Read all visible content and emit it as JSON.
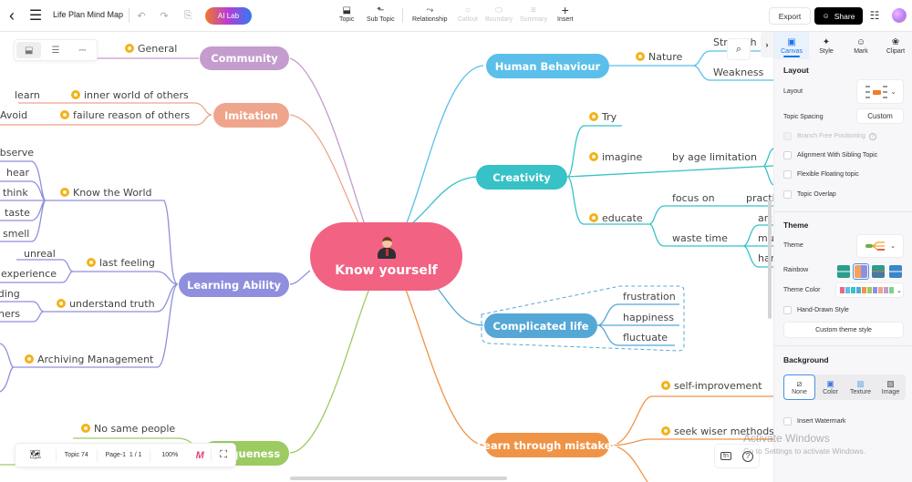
{
  "topbar": {
    "title": "Life Plan Mind Map",
    "ai_lab": "AI Lab",
    "tools": [
      {
        "label": "Topic",
        "icon": "topic-icon",
        "enabled": true
      },
      {
        "label": "Sub Topic",
        "icon": "subtopic-icon",
        "enabled": true
      },
      {
        "label": "Relationship",
        "icon": "relationship-icon",
        "enabled": true
      },
      {
        "label": "Callout",
        "icon": "callout-icon",
        "enabled": false
      },
      {
        "label": "Boundary",
        "icon": "boundary-icon",
        "enabled": false
      },
      {
        "label": "Summary",
        "icon": "summary-icon",
        "enabled": false
      },
      {
        "label": "Insert",
        "icon": "plus-icon",
        "enabled": true
      }
    ],
    "export": "Export",
    "share": "Share"
  },
  "mindmap": {
    "central": "Know yourself",
    "colors": {
      "central": "#f26283",
      "community": "#c49ccd",
      "imitation": "#eea58c",
      "learning": "#8f8fde",
      "uniqueness": "#9ccb61",
      "human": "#5bbfe9",
      "creativity": "#36c2c6",
      "complicated": "#55a8d6",
      "mistakes": "#ef9447"
    },
    "left": {
      "community": {
        "label": "Community",
        "children": [
          "General"
        ]
      },
      "imitation": {
        "label": "Imitation",
        "children": [
          "inner world of others",
          "failure reason of others"
        ],
        "leaves": [
          "learn",
          "Avoid"
        ]
      },
      "learning": {
        "label": "Learning Ability",
        "children": [
          "Know the World",
          "last feeling",
          "understand truth",
          "Archiving Management"
        ],
        "know_world_leaves": [
          "observe",
          "hear",
          "think",
          "taste",
          "smell"
        ],
        "last_feeling_leaves": [
          "unreal",
          "experience"
        ],
        "understand_leaves": [
          "reading",
          "others"
        ]
      },
      "uniqueness": {
        "label": "Uniqueness",
        "children": [
          "No same people"
        ]
      }
    },
    "right": {
      "human": {
        "label": "Human Behaviour",
        "children": [
          "Nature"
        ],
        "leaves": [
          "Strength",
          "Weakness"
        ]
      },
      "creativity": {
        "label": "Creativity",
        "children": [
          "Try",
          "imagine",
          "educate"
        ],
        "imagine_leaves": [
          "by age limitation"
        ],
        "educate_leaves": [
          "focus on",
          "waste time"
        ],
        "focus_leaves": [
          "practice"
        ],
        "waste_leaves": [
          "art",
          "music",
          "handwork"
        ]
      },
      "complicated": {
        "label": "Complicated life",
        "children": [
          "frustration",
          "happiness",
          "fluctuate"
        ]
      },
      "mistakes": {
        "label": "Learn through mistakes",
        "children": [
          "self-improvement",
          "seek wiser methods"
        ]
      }
    }
  },
  "statusbar": {
    "topic_count": "Topic 74",
    "page": "Page-1",
    "page_of": "1 / 1",
    "zoom": "100%"
  },
  "panel": {
    "tabs": [
      {
        "label": "Canvas",
        "icon": "canvas-icon",
        "active": true
      },
      {
        "label": "Style",
        "icon": "style-icon",
        "active": false
      },
      {
        "label": "Mark",
        "icon": "mark-icon",
        "active": false
      },
      {
        "label": "Clipart",
        "icon": "clipart-icon",
        "active": false
      }
    ],
    "layout": {
      "title": "Layout",
      "layout_label": "Layout",
      "spacing_label": "Topic Spacing",
      "spacing_value": "Custom",
      "options": [
        {
          "label": "Branch Free Positioning",
          "checked": false,
          "disabled": true
        },
        {
          "label": "Alignment With Sibling Topic",
          "checked": false,
          "disabled": false
        },
        {
          "label": "Flexible Floating topic",
          "checked": false,
          "disabled": false
        },
        {
          "label": "Topic Overlap",
          "checked": false,
          "disabled": false
        }
      ]
    },
    "theme": {
      "title": "Theme",
      "theme_label": "Theme",
      "rainbow_label": "Rainbow",
      "rainbow_selected_index": 1,
      "theme_color_label": "Theme Color",
      "theme_colors": [
        "#f26283",
        "#5bbfe9",
        "#36c2c6",
        "#55a8d6",
        "#ef9447",
        "#9ccb61",
        "#8f8fde",
        "#eea58c",
        "#c49ccd",
        "#7fcf8b"
      ],
      "hand_drawn": "Hand-Drawn Style",
      "custom_button": "Custom theme style"
    },
    "background": {
      "title": "Background",
      "options": [
        {
          "label": "None",
          "icon": "none-icon",
          "active": true
        },
        {
          "label": "Color",
          "icon": "color-icon",
          "active": false
        },
        {
          "label": "Texture",
          "icon": "texture-icon",
          "active": false
        },
        {
          "label": "Image",
          "icon": "image-icon",
          "active": false
        }
      ],
      "watermark": "Insert Watermark"
    }
  },
  "os_watermark": {
    "line1": "Activate Windows",
    "line2": "Go to Settings to activate Windows."
  }
}
